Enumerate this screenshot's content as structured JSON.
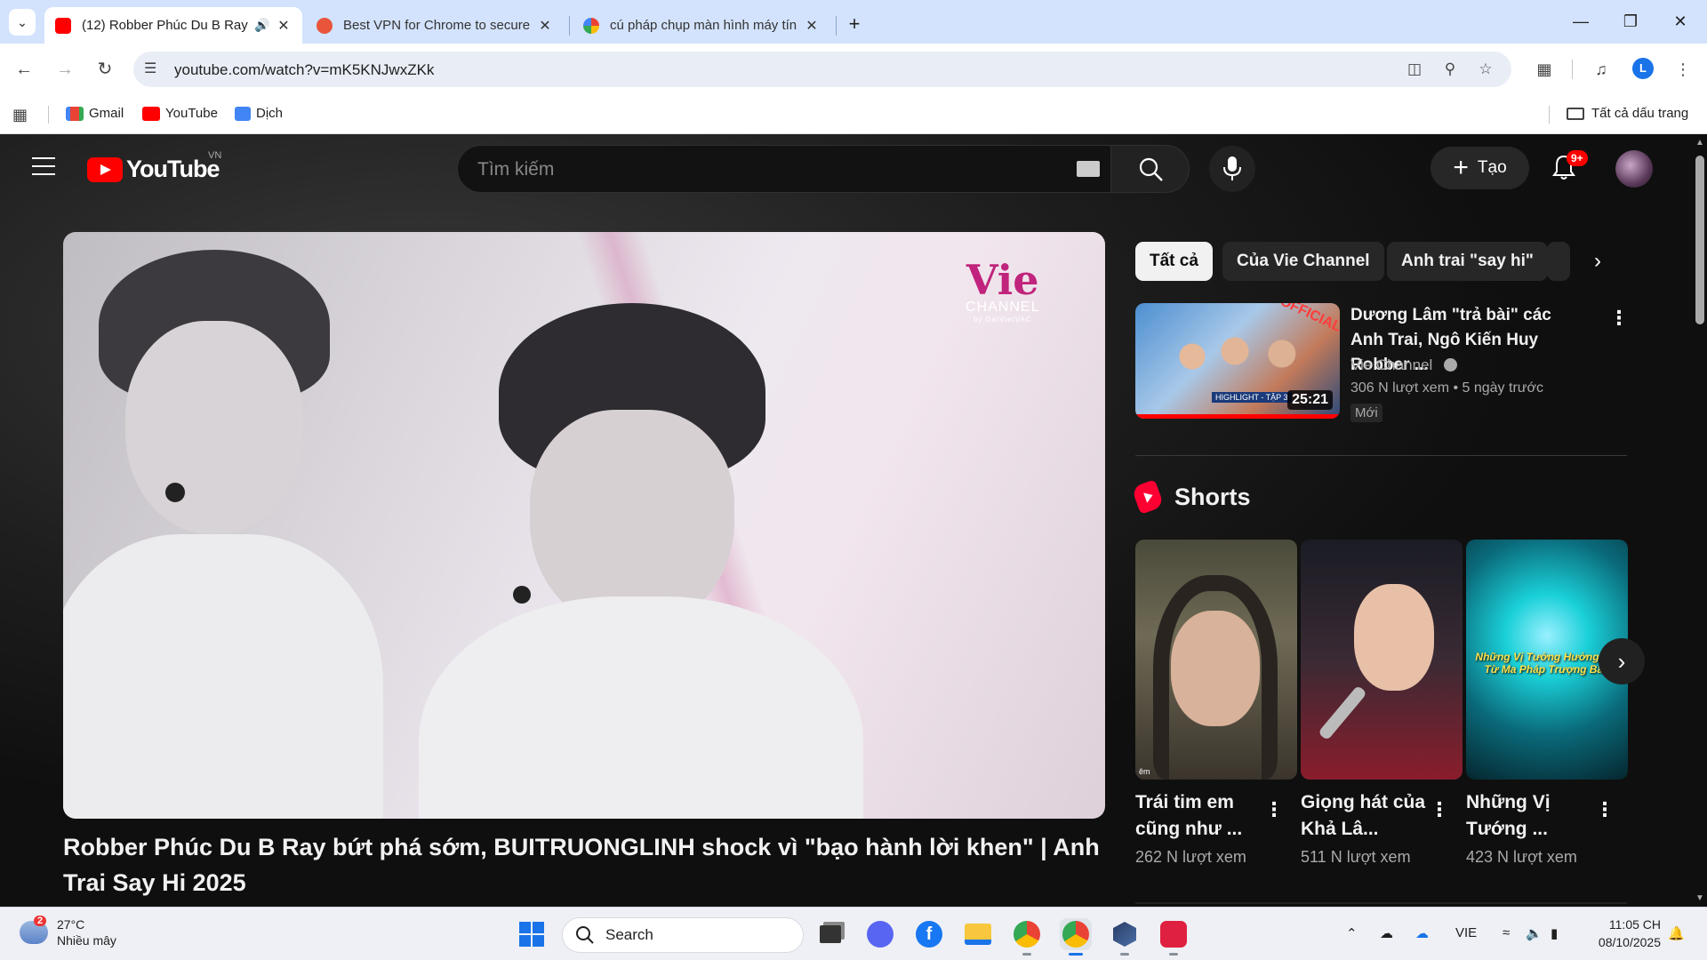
{
  "browser": {
    "tabs": [
      {
        "title": "(12) Robber Phúc Du B Ray",
        "active": true,
        "audio": true
      },
      {
        "title": "Best VPN for Chrome to secure",
        "active": false
      },
      {
        "title": "cú pháp chụp màn hình máy tín",
        "active": false
      }
    ],
    "new_tab_icon": "plus-icon",
    "url": "youtube.com/watch?v=mK5KNJwxZKk",
    "bookmarks": [
      {
        "label": "Gmail",
        "icon": "gmail-icon"
      },
      {
        "label": "YouTube",
        "icon": "youtube-icon"
      },
      {
        "label": "Dịch",
        "icon": "translate-icon"
      }
    ],
    "all_bookmarks_label": "Tất cả dấu trang",
    "profile_initial": "L"
  },
  "youtube": {
    "logo_text": "YouTube",
    "region": "VN",
    "search_placeholder": "Tìm kiếm",
    "create_label": "Tạo",
    "notification_badge": "9+",
    "player": {
      "channel_watermark": "Vie",
      "channel_watermark_sub": "CHANNEL",
      "channel_watermark_tiny": "by DatVietVAC"
    },
    "video_title": "Robber Phúc Du B Ray bứt phá sớm, BUITRUONGLINH shock vì \"bạo hành lời khen\" | Anh Trai Say Hi 2025",
    "chips": [
      "Tất cả",
      "Của Vie Channel",
      "Anh trai \"say hi\""
    ],
    "suggested": {
      "title": "Dương Lâm \"trả bài\" các Anh Trai, Ngô Kiến Huy Robber ...",
      "channel": "Vie Channel",
      "meta": "306 N lượt xem • 5 ngày trước",
      "badge": "Mới",
      "duration": "25:21",
      "thumb_tag": "OFFICIAL",
      "thumb_strip": "HIGHLIGHT - TẬP 3"
    },
    "shorts_label": "Shorts",
    "shorts": [
      {
        "title": "Trái tim em cũng như ...",
        "views": "262 N lượt xem",
        "thumb_caption": "êm"
      },
      {
        "title": "Giọng hát của Khả Lâ...",
        "views": "511 N lượt xem"
      },
      {
        "title": "Những Vị Tướng ...",
        "views": "423 N lượt xem",
        "thumb_caption": "Những Vị Tướng Hướng Lợi Từ Ma Pháp Trượng Bão"
      }
    ]
  },
  "taskbar": {
    "weather_temp": "27°C",
    "weather_desc": "Nhiều mây",
    "weather_badge": "2",
    "search_label": "Search",
    "language": "VIE",
    "time": "11:05 CH",
    "date": "08/10/2025"
  }
}
